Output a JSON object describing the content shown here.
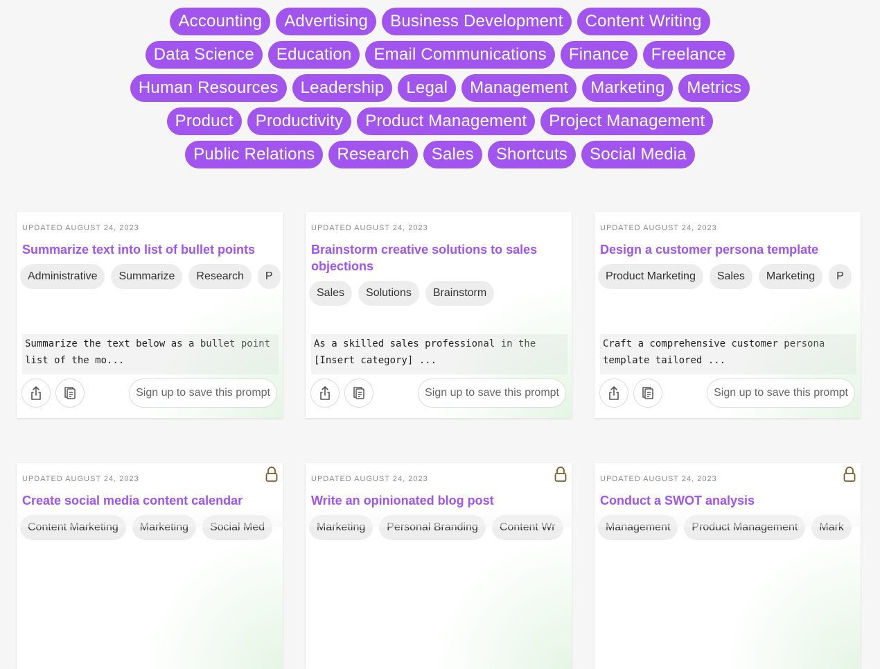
{
  "categories": [
    "Accounting",
    "Advertising",
    "Business Development",
    "Content Writing",
    "Data Science",
    "Education",
    "Email Communications",
    "Finance",
    "Freelance",
    "Human Resources",
    "Leadership",
    "Legal",
    "Management",
    "Marketing",
    "Metrics",
    "Product",
    "Productivity",
    "Product Management",
    "Project Management",
    "Public Relations",
    "Research",
    "Sales",
    "Shortcuts",
    "Social Media"
  ],
  "save_label": "Sign up to save this prompt",
  "cards": [
    {
      "date": "UPDATED AUGUST 24, 2023",
      "title": "Summarize text into list of bullet points",
      "tags": [
        "Administrative",
        "Summarize",
        "Research",
        "P"
      ],
      "snippet_l1": "Summarize the text below as a bullet point",
      "snippet_l2": "list of the mo..."
    },
    {
      "date": "UPDATED AUGUST 24, 2023",
      "title": "Brainstorm creative solutions to sales objections",
      "tags": [
        "Sales",
        "Solutions",
        "Brainstorm"
      ],
      "snippet_l1": "As a skilled sales professional in the",
      "snippet_l2": "[Insert category] ..."
    },
    {
      "date": "UPDATED AUGUST 24, 2023",
      "title": "Design a customer persona template",
      "tags": [
        "Product Marketing",
        "Sales",
        "Marketing",
        "P"
      ],
      "snippet_l1": "Craft a comprehensive customer persona",
      "snippet_l2": "template tailored ..."
    },
    {
      "date": "UPDATED AUGUST 24, 2023",
      "title": "Create social media content calendar",
      "tags": [
        "Content Marketing",
        "Marketing",
        "Social Med"
      ],
      "locked": true
    },
    {
      "date": "UPDATED AUGUST 24, 2023",
      "title": "Write an opinionated blog post",
      "tags": [
        "Marketing",
        "Personal Branding",
        "Content Wr"
      ],
      "locked": true
    },
    {
      "date": "UPDATED AUGUST 24, 2023",
      "title": "Conduct a SWOT analysis",
      "tags": [
        "Management",
        "Product Management",
        "Mark"
      ],
      "locked": true
    }
  ],
  "icons": {
    "share": "share-icon",
    "copy": "copy-icon",
    "lock": "lock-icon"
  }
}
